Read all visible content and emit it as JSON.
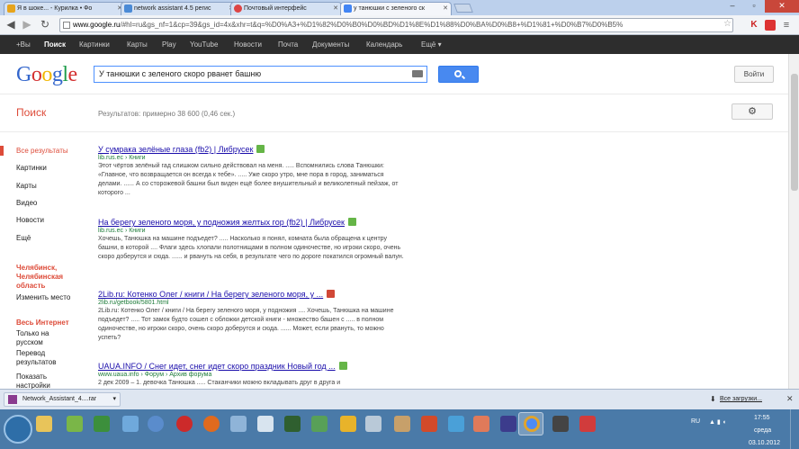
{
  "browser": {
    "tabs": [
      {
        "title": "Я в шоке... - Курилка • Фо",
        "fav": "#e7a41c"
      },
      {
        "title": "network assistant 4.5 регис",
        "fav": "#4a8ad6"
      },
      {
        "title": "Почтовый интерфейс",
        "fav": "#d44"
      },
      {
        "title": "у танюшки с зеленого ск",
        "fav": "#4285f4"
      }
    ],
    "url_prefix": "www.google.ru",
    "url_rest": "/#hl=ru&gs_nf=1&cp=39&gs_id=4x&xhr=t&q=%D0%A3+%D1%82%D0%B0%D0%BD%D1%8E%D1%88%D0%BA%D0%B8+%D1%81+%D0%B7%D0%B5%"
  },
  "gbar": {
    "items": [
      "+Вы",
      "Поиск",
      "Картинки",
      "Карты",
      "Play",
      "YouTube",
      "Новости",
      "Почта",
      "Документы",
      "Календарь",
      "Ещё ▾"
    ]
  },
  "header": {
    "logo": [
      "G",
      "o",
      "o",
      "g",
      "l",
      "e"
    ],
    "query": "У танюшки с зеленого скоро рванет башню",
    "signin": "Войти"
  },
  "subheader": {
    "title": "Поиск",
    "stats": "Результатов: примерно 38 600 (0,46 сек.)"
  },
  "leftnav": {
    "types": [
      "Все результаты",
      "Картинки",
      "Карты",
      "Видео",
      "Новости",
      "Ещё"
    ],
    "location_head": "Челябинск, Челябинская область",
    "location_change": "Изменить место",
    "internet_head": "Весь Интернет",
    "internet_items": [
      "Только на русском",
      "Перевод результатов",
      "Показать настройки"
    ]
  },
  "results": [
    {
      "title": "У сумрака зелёные глаза (fb2) | Либрусек",
      "url": "lib.rus.ec › Книги",
      "snippet": "Этот чёртов зелёный гад слишком сильно действовал на меня. ..... Вспомнились слова Танюшки: «Главное, что возвращается он всегда к тебе». ..... Уже скоро утро, мне пора в город, заниматься делами. ...... А со сторожевой башни был виден ещё более внушительный и великолепный пейзаж, от которого ..."
    },
    {
      "title": "На берегу зеленого моря, у подножия желтых гор (fb2) | Либрусек",
      "url": "lib.rus.ec › Книги",
      "snippet": "Хочешь, Танюшка на машине подъедет? ..... Насколько я понял, комната была обращена к центру башни, в которой .... Флаги здесь хлопали полотнищами в полном одиночестве, но игроки скоро, очень скоро доберутся и сюда. ...... и рвануть на себя, в результате чего по дороге покатился огромный валун."
    },
    {
      "title": "2Lib.ru: Котенко Олег / книги / На берегу зеленого моря, у ...",
      "url": "2lib.ru/getbook/5801.html",
      "snippet": "2Lib.ru: Котенко Олег / книги / На берегу зеленого моря, у подножия .... Хочешь, Танюшка на машине подъедет? ..... Тот замок будто сошел с обложки детской книги - множество башен с ..... в полном одиночестве, но игроки скоро, очень скоро доберутся и сюда. ...... Может, если рвануть, то можно успеть?"
    },
    {
      "title": "UAUA.INFO / Снег идет, снег идет скоро праздник Новый год ...",
      "url": "www.uaua.info › Форум › Архив форума",
      "snippet": "2 дек 2009 – 1. девочка Танюшка ..... Стаканчики можно вкладывать друг в друга и"
    }
  ],
  "downloads": {
    "file": "Network_Assistant_4....rar",
    "all": "Все загрузки..."
  },
  "taskbar": {
    "lang": "RU",
    "time": "17:55",
    "day": "среда",
    "date": "03.10.2012"
  }
}
